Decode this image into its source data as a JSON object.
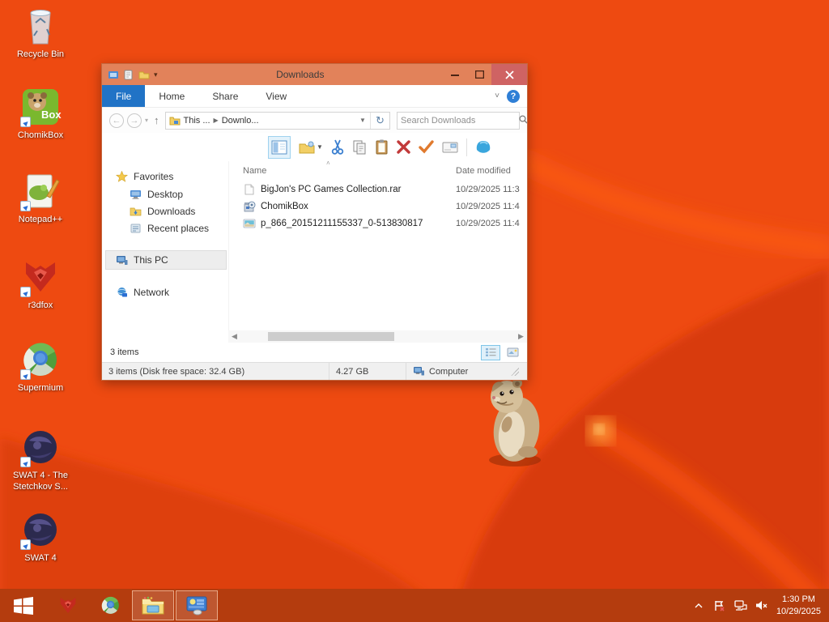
{
  "colors": {
    "desktop_orange": "#ee4a11",
    "desktop_dark_swirl": "#d83b0d",
    "window_chrome": "#e2825a",
    "file_tab_blue": "#2173c6",
    "close_button": "#cf6363",
    "taskbar": "#b43c0e",
    "selection_bg": "#ededed"
  },
  "desktop": {
    "icons": [
      {
        "label": "Recycle Bin",
        "icon": "recycle-bin-icon"
      },
      {
        "label": "ChomikBox",
        "icon": "chomikbox-icon"
      },
      {
        "label": "Notepad++",
        "icon": "notepad-plus-plus-icon"
      },
      {
        "label": "r3dfox",
        "icon": "r3dfox-icon"
      },
      {
        "label": "Supermium",
        "icon": "supermium-icon"
      },
      {
        "label": "SWAT 4 - The Stetchkov S...",
        "icon": "swat4-icon"
      },
      {
        "label": "SWAT 4",
        "icon": "swat4-icon"
      }
    ],
    "hamster": "hamster-mascot"
  },
  "window": {
    "title": "Downloads",
    "tabs": [
      {
        "label": "File"
      },
      {
        "label": "Home"
      },
      {
        "label": "Share"
      },
      {
        "label": "View"
      }
    ],
    "address": {
      "crumb1": "This ...",
      "crumb2": "Downlo...",
      "search_placeholder": "Search Downloads"
    },
    "toolbar_icons": [
      "preview-pane",
      "new-folder",
      "cut",
      "copy",
      "paste",
      "delete",
      "check",
      "mail",
      "shell"
    ],
    "nav": {
      "favorites": {
        "label": "Favorites",
        "items": [
          "Desktop",
          "Downloads",
          "Recent places"
        ]
      },
      "this_pc": "This PC",
      "network": "Network"
    },
    "columns": {
      "name": "Name",
      "date": "Date modified"
    },
    "files": [
      {
        "name": "BigJon's PC Games Collection.rar",
        "date": "10/29/2025 11:3",
        "icon": "archive-file-icon"
      },
      {
        "name": "ChomikBox",
        "date": "10/29/2025 11:4",
        "icon": "installer-file-icon"
      },
      {
        "name": "p_866_20151211155337_0-513830817",
        "date": "10/29/2025 11:4",
        "icon": "image-file-icon"
      }
    ],
    "status": {
      "items_label": "3 items",
      "disk": "3 items (Disk free space: 32.4 GB)",
      "size": "4.27 GB",
      "location": "Computer"
    }
  },
  "taskbar": {
    "clock": {
      "time": "1:30 PM",
      "date": "10/29/2025"
    }
  }
}
